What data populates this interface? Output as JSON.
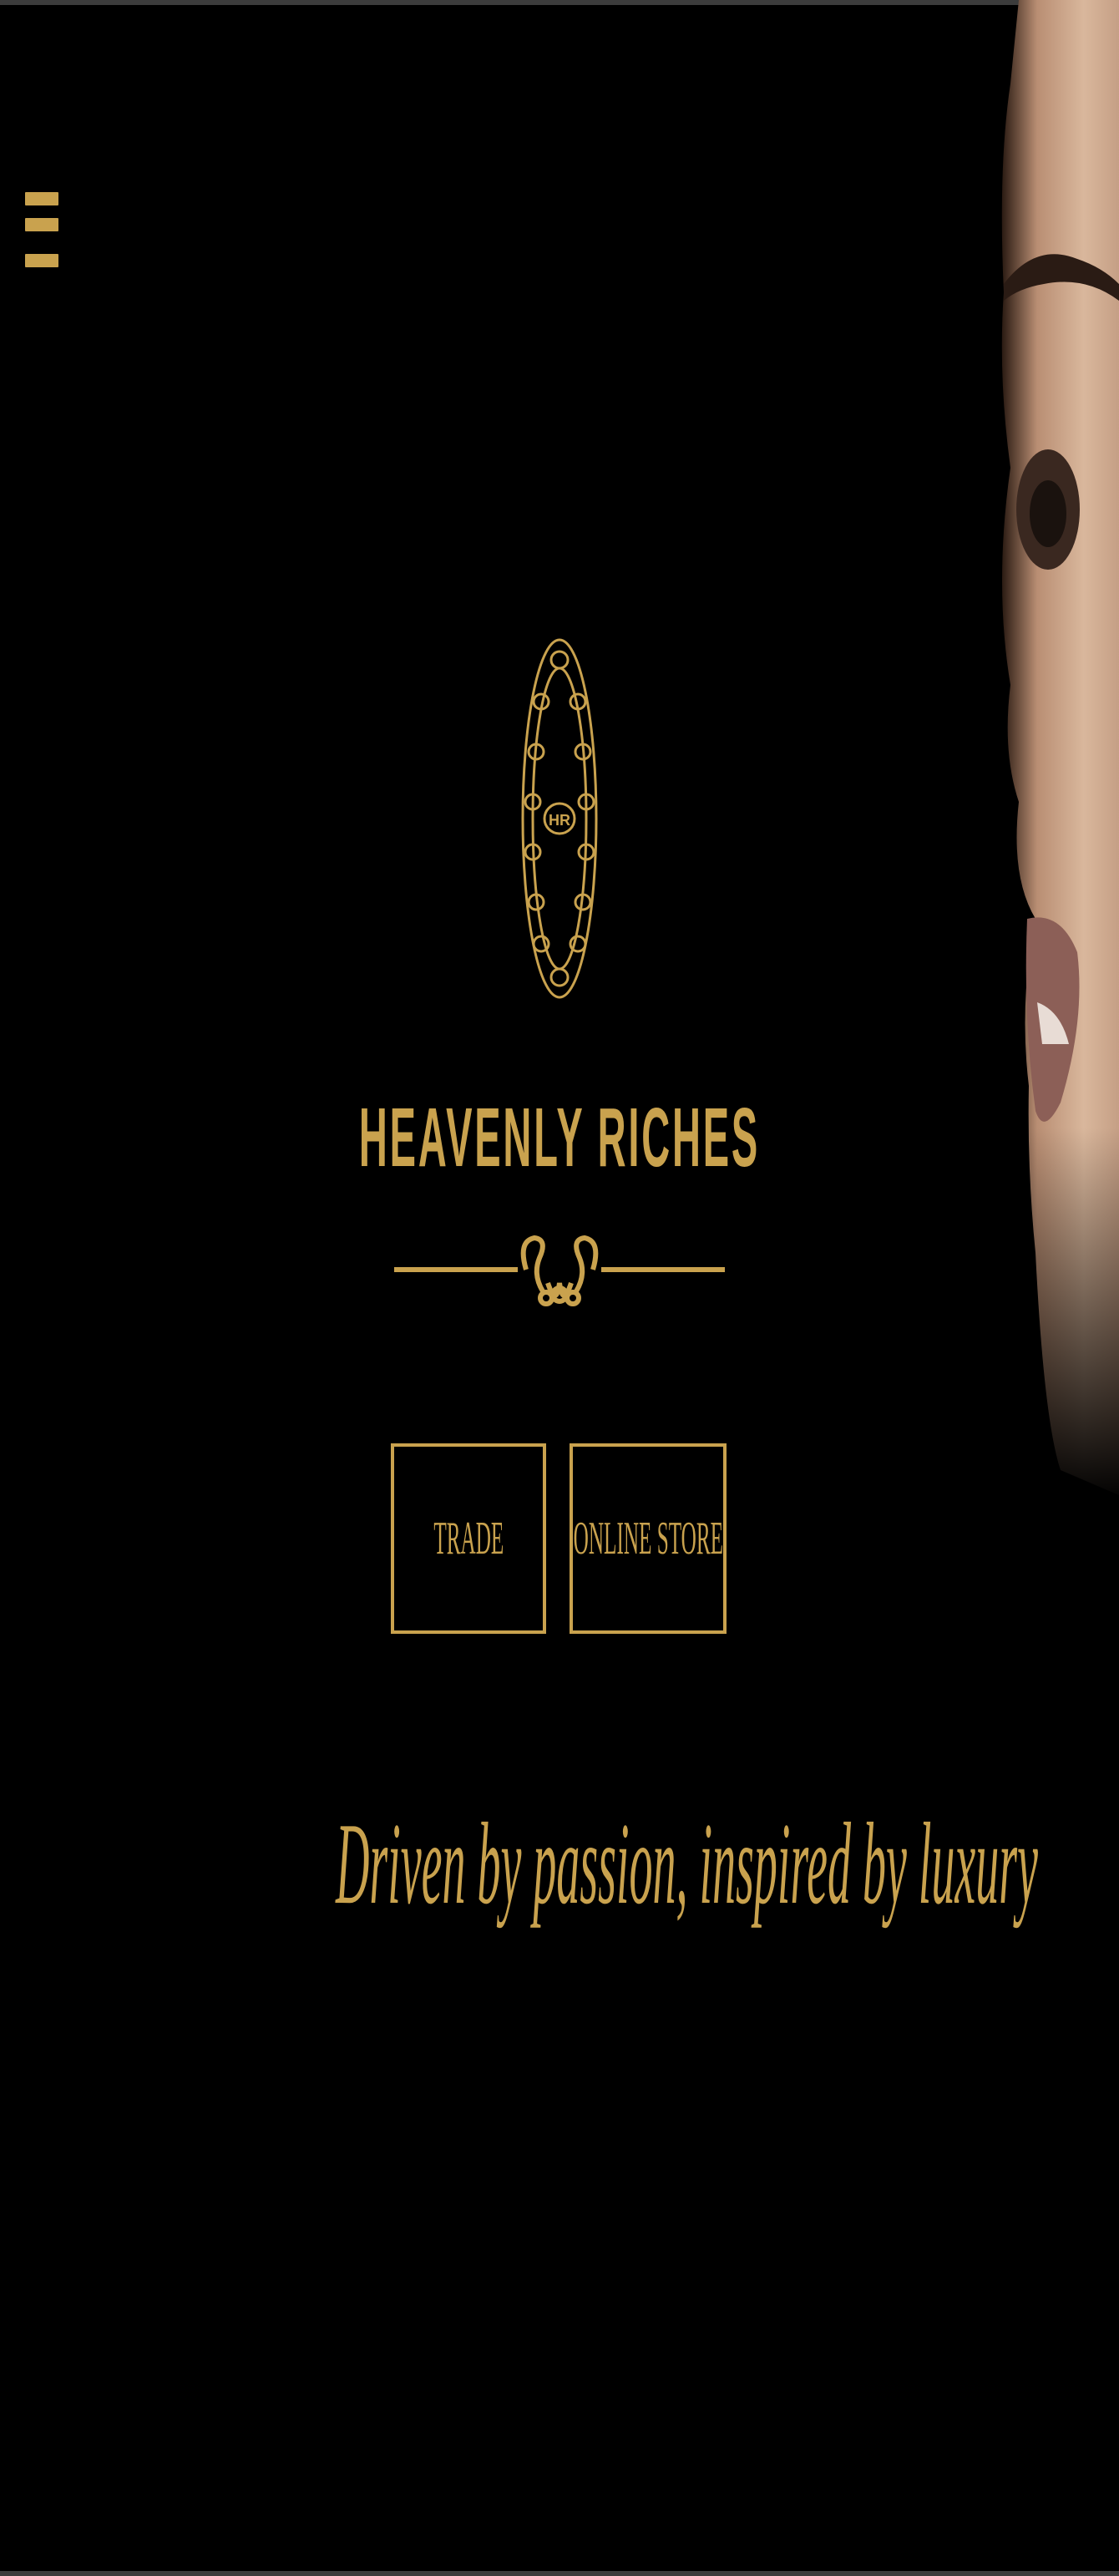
{
  "brand": {
    "name": "HEAVENLY RICHES",
    "monogram": "HR",
    "tagline": "Driven by passion, inspired by luxury"
  },
  "nav": {
    "menu_icon": "hamburger-menu-icon"
  },
  "buttons": {
    "trade_label": "TRADE",
    "store_label": "ONLINE STORE"
  },
  "colors": {
    "background": "#000000",
    "gold": "#c9a24e"
  }
}
